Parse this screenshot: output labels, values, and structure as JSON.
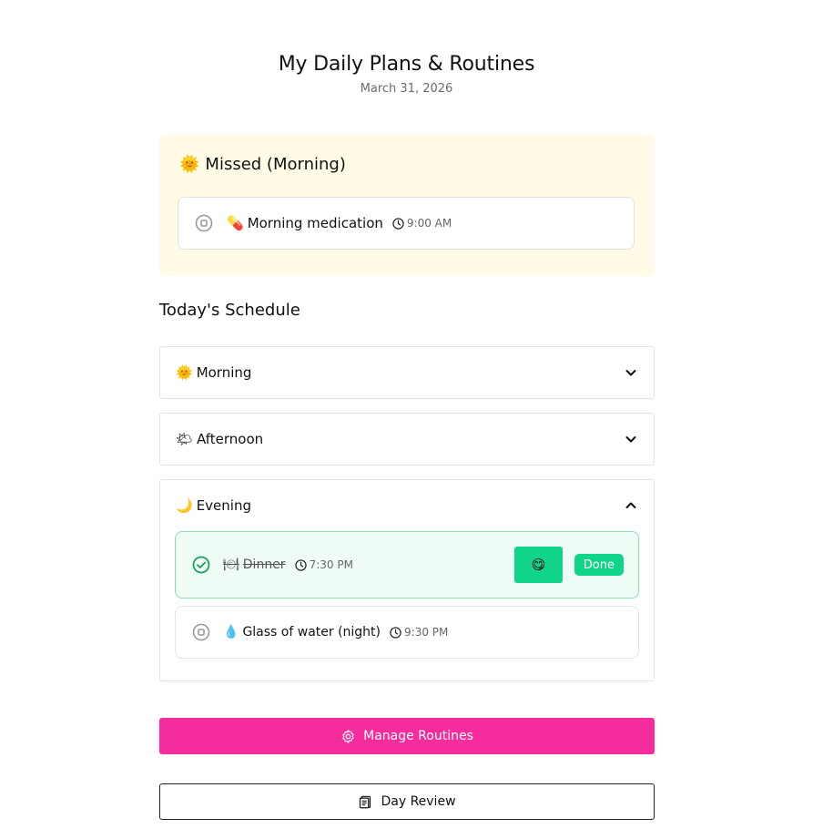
{
  "header": {
    "title": "My Daily Plans & Routines",
    "date": "March 31, 2026"
  },
  "missed": {
    "heading_emoji": "🌞",
    "heading": "Missed (Morning)",
    "task": {
      "emoji": "💊",
      "name": "Morning medication",
      "time": "9:00 AM"
    }
  },
  "schedule": {
    "title": "Today's Schedule",
    "sections": [
      {
        "emoji": "🌞",
        "label": "Morning",
        "expanded": false
      },
      {
        "emoji": "🌤",
        "label": "Afternoon",
        "expanded": false
      },
      {
        "emoji": "🌙",
        "label": "Evening",
        "expanded": true
      }
    ],
    "evening_tasks": [
      {
        "emoji": "🍽",
        "name": "Dinner",
        "time": "7:30 PM",
        "status": "done",
        "reaction": "😋",
        "done_label": "Done"
      },
      {
        "emoji": "💧",
        "name": "Glass of water (night)",
        "time": "9:30 PM",
        "status": "pending"
      }
    ]
  },
  "buttons": {
    "manage": "Manage Routines",
    "review": "Day Review"
  },
  "colors": {
    "accent_pink": "#f52c9b",
    "done_green": "#10d48a",
    "missed_bg": "#fffbe6"
  }
}
